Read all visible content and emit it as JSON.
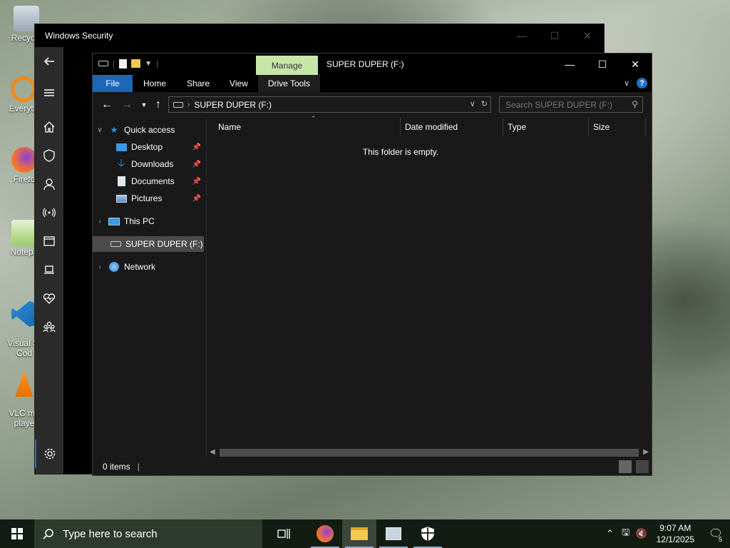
{
  "desktop": {
    "icons": [
      {
        "label": "Recycle",
        "icon": "recycle-bin-icon"
      },
      {
        "label": "Everyth",
        "icon": "everything-search-icon"
      },
      {
        "label": "Firefo",
        "icon": "firefox-icon"
      },
      {
        "label": "Notepa",
        "icon": "notepad-plus-icon"
      },
      {
        "label": "Visual St\nCod",
        "icon": "vscode-icon"
      },
      {
        "label": "VLC me\nplaye",
        "icon": "vlc-icon"
      }
    ]
  },
  "windows_security": {
    "title": "Windows Security",
    "nav_icons": [
      "back-arrow-icon",
      "hamburger-menu-icon",
      "home-icon",
      "shield-icon",
      "account-icon",
      "wireless-icon",
      "app-browser-icon",
      "laptop-icon",
      "heart-health-icon",
      "family-icon",
      "settings-gear-icon"
    ]
  },
  "explorer": {
    "title": "SUPER DUPER (F:)",
    "manage_label": "Manage",
    "ribbon_tabs": [
      "File",
      "Home",
      "Share",
      "View",
      "Drive Tools"
    ],
    "address": "SUPER DUPER (F:)",
    "search_placeholder": "Search SUPER DUPER (F:)",
    "nav_tree": [
      {
        "label": "Quick access",
        "icon": "star-icon",
        "expandable": true
      },
      {
        "label": "Desktop",
        "icon": "desktop-folder-icon",
        "pinned": true
      },
      {
        "label": "Downloads",
        "icon": "downloads-folder-icon",
        "pinned": true
      },
      {
        "label": "Documents",
        "icon": "documents-folder-icon",
        "pinned": true
      },
      {
        "label": "Pictures",
        "icon": "pictures-folder-icon",
        "pinned": true
      },
      {
        "label": "This PC",
        "icon": "monitor-icon",
        "expandable": true
      },
      {
        "label": "SUPER DUPER (F:)",
        "icon": "drive-icon",
        "selected": true
      },
      {
        "label": "Network",
        "icon": "network-icon",
        "expandable": true
      }
    ],
    "columns": [
      "Name",
      "Date modified",
      "Type",
      "Size"
    ],
    "empty_message": "This folder is empty.",
    "status_items": "0 items"
  },
  "taskbar": {
    "search_placeholder": "Type here to search",
    "apps": [
      "task-view-icon",
      "firefox-icon",
      "file-explorer-icon",
      "task-manager-icon",
      "windows-security-icon"
    ],
    "time": "9:07 AM",
    "date": "12/1/2025",
    "notification_count": "5"
  }
}
